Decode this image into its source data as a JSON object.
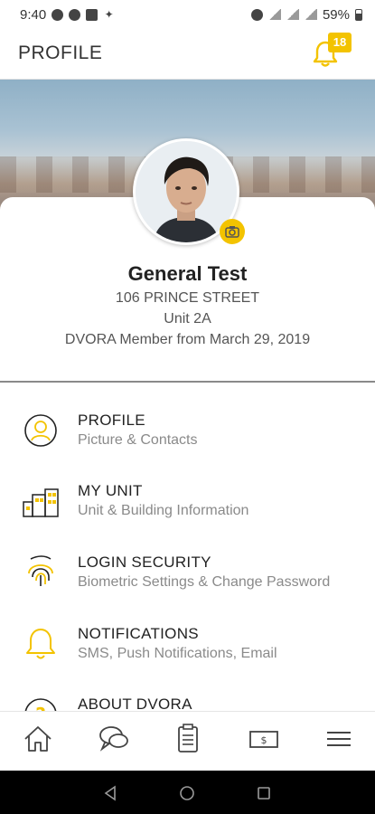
{
  "status_bar": {
    "time": "9:40",
    "battery": "59%"
  },
  "header": {
    "title": "PROFILE",
    "notification_count": "18"
  },
  "profile": {
    "name": "General Test",
    "address": "106 PRINCE STREET",
    "unit": "Unit 2A",
    "member_since": "DVORA Member from March 29, 2019"
  },
  "menu": [
    {
      "title": "PROFILE",
      "subtitle": "Picture & Contacts",
      "icon": "user-circle-icon"
    },
    {
      "title": "MY UNIT",
      "subtitle": "Unit & Building Information",
      "icon": "buildings-icon"
    },
    {
      "title": "LOGIN SECURITY",
      "subtitle": "Biometric Settings & Change Password",
      "icon": "fingerprint-icon"
    },
    {
      "title": "NOTIFICATIONS",
      "subtitle": "SMS, Push Notifications, Email",
      "icon": "bell-icon"
    },
    {
      "title": "ABOUT DVORA",
      "subtitle": "",
      "icon": "question-icon"
    }
  ],
  "tabs": [
    "home-icon",
    "chat-icon",
    "clipboard-icon",
    "money-icon",
    "menu-icon"
  ],
  "colors": {
    "accent": "#f3c300",
    "text": "#222222",
    "subtext": "#8a8a8a"
  }
}
